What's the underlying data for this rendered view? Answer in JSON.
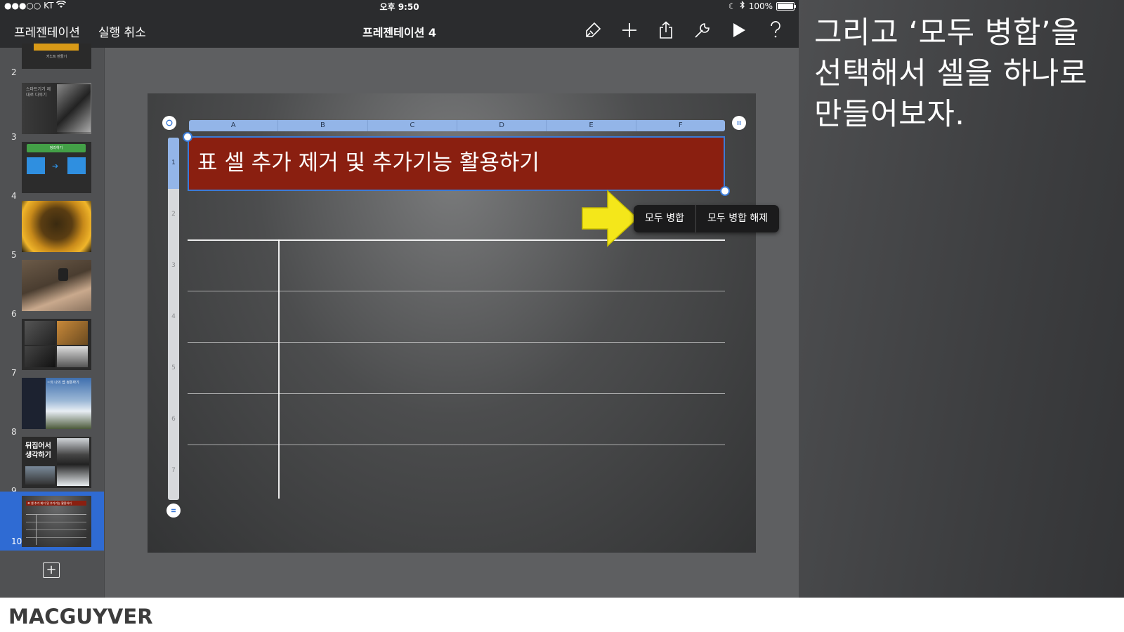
{
  "status_bar": {
    "carrier": "●●●○○ KT",
    "time": "오후 9:50",
    "battery": "100%",
    "battery_level": 1.0
  },
  "toolbar": {
    "presentations_label": "프레젠테이션",
    "undo_label": "실행 취소",
    "title": "프레젠테이션 4",
    "icons": [
      "format-brush-icon",
      "add-icon",
      "share-icon",
      "wrench-icon",
      "play-icon",
      "help-icon"
    ]
  },
  "sidebar": {
    "slides": [
      {
        "number": "2",
        "thumb_text": "키노트 만들기"
      },
      {
        "number": "3",
        "thumb_text": "스마트기기 제대로 다루기"
      },
      {
        "number": "4",
        "thumb_text": "정리하기"
      },
      {
        "number": "5",
        "thumb_text": ""
      },
      {
        "number": "6",
        "thumb_text": ""
      },
      {
        "number": "7",
        "thumb_text": ""
      },
      {
        "number": "8",
        "thumb_text": "~의 나의 앱 정돈하기"
      },
      {
        "number": "9",
        "thumb_text": "뒤집어서 생각하기"
      },
      {
        "number": "10",
        "thumb_text": "표 셀 추가 제거 및 추가기능 활용하기"
      }
    ],
    "active_slide": "10"
  },
  "table": {
    "columns": [
      "A",
      "B",
      "C",
      "D",
      "E",
      "F"
    ],
    "rows": [
      "1",
      "2",
      "3",
      "4",
      "5",
      "6",
      "7"
    ],
    "selected_row": "1",
    "title_cell_text": "표 셀 추가 제거 및 추가기능 활용하기",
    "colors": {
      "title_cell": "#8a1f10",
      "selection": "#3a7bd8",
      "header": "#93b5e8"
    }
  },
  "popup": {
    "merge_all": "모두 병합",
    "unmerge_all": "모두 병합 해제"
  },
  "caption": {
    "text": "그리고 ‘모두 병합’을 선택해서 셀을 하나로 만들어보자."
  },
  "footer": {
    "brand": "MACGUYVER"
  }
}
